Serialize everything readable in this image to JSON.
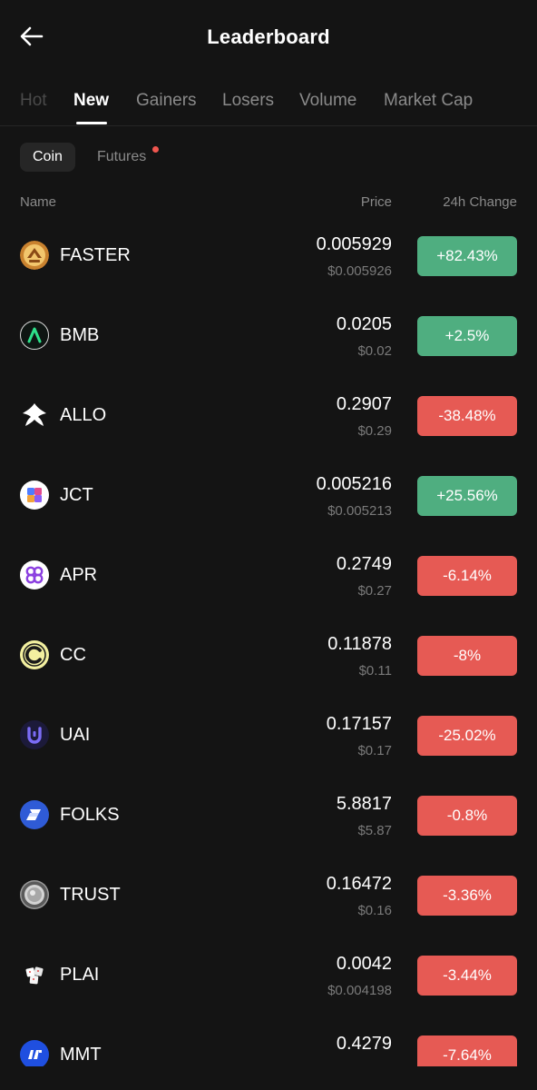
{
  "header": {
    "title": "Leaderboard"
  },
  "tabs": [
    {
      "label": "Hot",
      "state": "faded"
    },
    {
      "label": "New",
      "state": "active"
    },
    {
      "label": "Gainers",
      "state": "normal"
    },
    {
      "label": "Losers",
      "state": "normal"
    },
    {
      "label": "Volume",
      "state": "normal"
    },
    {
      "label": "Market Cap",
      "state": "normal"
    }
  ],
  "filters": {
    "coin_label": "Coin",
    "futures_label": "Futures",
    "futures_has_notification": true
  },
  "columns": {
    "name": "Name",
    "price": "Price",
    "change": "24h Change"
  },
  "colors": {
    "background": "#141414",
    "gain": "#4fae80",
    "loss": "#e65a54",
    "notification": "#f0564f"
  },
  "coins": [
    {
      "symbol": "FASTER",
      "icon": "faster-coin-icon",
      "price": "0.005929",
      "price_usd": "$0.005926",
      "change": "+82.43%",
      "direction": "up"
    },
    {
      "symbol": "BMB",
      "icon": "bmb-coin-icon",
      "price": "0.0205",
      "price_usd": "$0.02",
      "change": "+2.5%",
      "direction": "up"
    },
    {
      "symbol": "ALLO",
      "icon": "allo-coin-icon",
      "price": "0.2907",
      "price_usd": "$0.29",
      "change": "-38.48%",
      "direction": "down"
    },
    {
      "symbol": "JCT",
      "icon": "jct-coin-icon",
      "price": "0.005216",
      "price_usd": "$0.005213",
      "change": "+25.56%",
      "direction": "up"
    },
    {
      "symbol": "APR",
      "icon": "apr-coin-icon",
      "price": "0.2749",
      "price_usd": "$0.27",
      "change": "-6.14%",
      "direction": "down"
    },
    {
      "symbol": "CC",
      "icon": "cc-coin-icon",
      "price": "0.11878",
      "price_usd": "$0.11",
      "change": "-8%",
      "direction": "down"
    },
    {
      "symbol": "UAI",
      "icon": "uai-coin-icon",
      "price": "0.17157",
      "price_usd": "$0.17",
      "change": "-25.02%",
      "direction": "down"
    },
    {
      "symbol": "FOLKS",
      "icon": "folks-coin-icon",
      "price": "5.8817",
      "price_usd": "$5.87",
      "change": "-0.8%",
      "direction": "down"
    },
    {
      "symbol": "TRUST",
      "icon": "trust-coin-icon",
      "price": "0.16472",
      "price_usd": "$0.16",
      "change": "-3.36%",
      "direction": "down"
    },
    {
      "symbol": "PLAI",
      "icon": "plai-coin-icon",
      "price": "0.0042",
      "price_usd": "$0.004198",
      "change": "-3.44%",
      "direction": "down"
    },
    {
      "symbol": "MMT",
      "icon": "mmt-coin-icon",
      "price": "0.4279",
      "price_usd": "",
      "change": "-7.64%",
      "direction": "down"
    }
  ]
}
